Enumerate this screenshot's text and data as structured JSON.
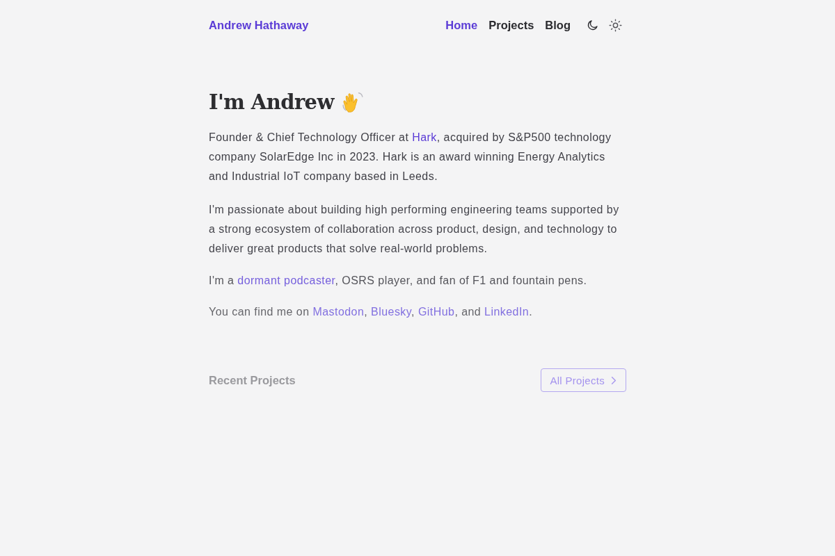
{
  "header": {
    "site_title": "Andrew Hathaway",
    "nav": [
      {
        "label": "Home",
        "selected": true
      },
      {
        "label": "Projects",
        "selected": false
      },
      {
        "label": "Blog",
        "selected": false
      }
    ]
  },
  "hero": {
    "heading": "I'm Andrew",
    "paragraphs": [
      {
        "parts": [
          {
            "kind": "text",
            "text": "Founder & Chief Technology Officer at "
          },
          {
            "kind": "link",
            "text": "Hark"
          },
          {
            "kind": "text",
            "text": ", acquired by S&P500 technology company SolarEdge Inc in 2023. Hark is an award winning Energy Analytics and Industrial IoT company based in Leeds."
          }
        ]
      },
      {
        "parts": [
          {
            "kind": "text",
            "text": "I'm passionate about building high performing engineering teams supported by a strong ecosystem of collaboration across product, design, and technology to deliver great products that solve real-world problems."
          }
        ]
      },
      {
        "parts": [
          {
            "kind": "text",
            "text": "I'm a "
          },
          {
            "kind": "link",
            "text": "dormant podcaster"
          },
          {
            "kind": "text",
            "text": ", OSRS player, and fan of F1 and fountain pens."
          }
        ]
      },
      {
        "parts": [
          {
            "kind": "text",
            "text": "You can find me on "
          },
          {
            "kind": "link",
            "text": "Mastodon"
          },
          {
            "kind": "text",
            "text": ", "
          },
          {
            "kind": "link",
            "text": "Bluesky"
          },
          {
            "kind": "text",
            "text": ", "
          },
          {
            "kind": "link",
            "text": "GitHub"
          },
          {
            "kind": "text",
            "text": ", and "
          },
          {
            "kind": "link",
            "text": "LinkedIn"
          },
          {
            "kind": "text",
            "text": "."
          }
        ]
      }
    ]
  },
  "recent_projects": {
    "title": "Recent Projects",
    "button": "All Projects"
  }
}
